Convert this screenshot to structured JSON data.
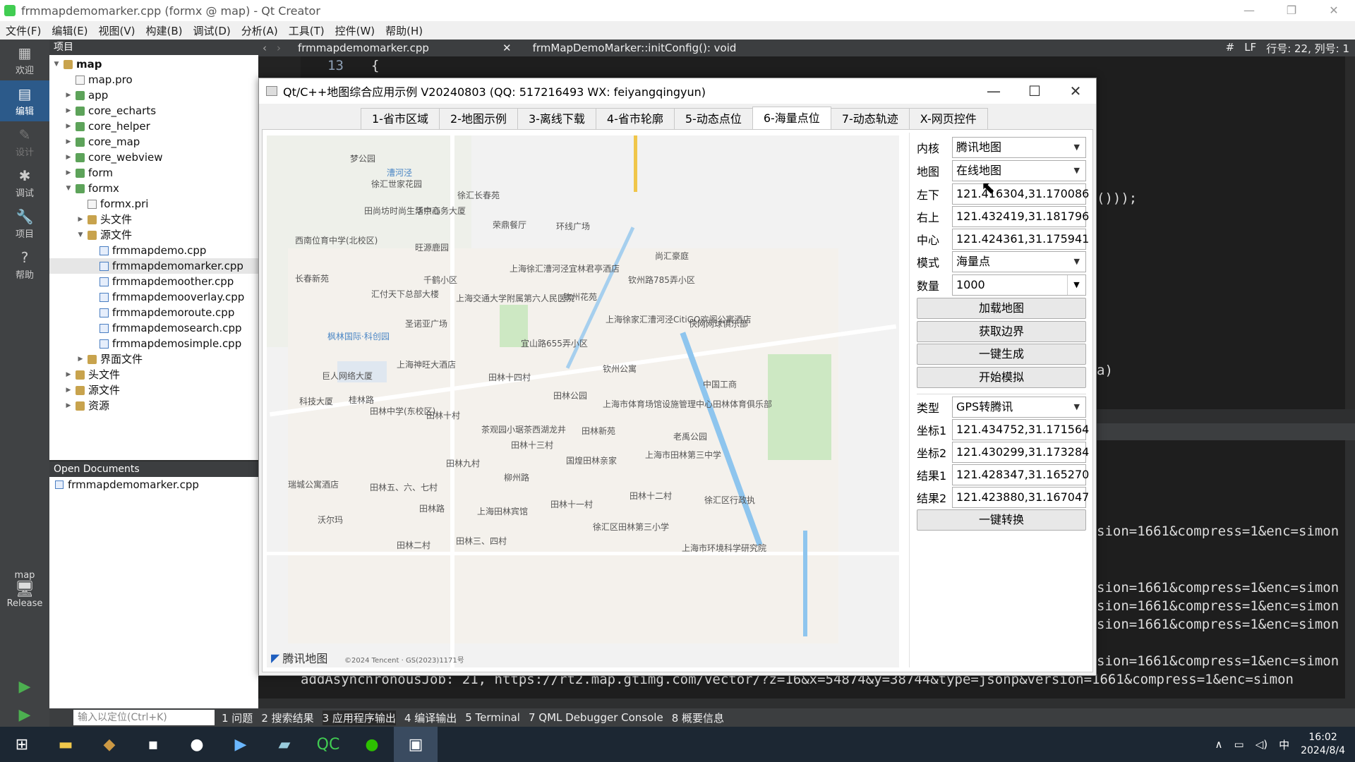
{
  "qc": {
    "title": "frmmapdemomarker.cpp (formx @ map) - Qt Creator",
    "menu": [
      "文件(F)",
      "编辑(E)",
      "视图(V)",
      "构建(B)",
      "调试(D)",
      "分析(A)",
      "工具(T)",
      "控件(W)",
      "帮助(H)"
    ],
    "modes": [
      {
        "label": "欢迎",
        "icon": "▦"
      },
      {
        "label": "编辑",
        "icon": "▤"
      },
      {
        "label": "设计",
        "icon": "✎"
      },
      {
        "label": "调试",
        "icon": "✱"
      },
      {
        "label": "项目",
        "icon": "🔧"
      },
      {
        "label": "帮助",
        "icon": "?"
      }
    ],
    "kit": {
      "name": "map",
      "config": "Release"
    },
    "project_header": "项目",
    "tree": [
      {
        "indent": 0,
        "arrow": "▼",
        "icon": "proj",
        "label": "map",
        "bold": true
      },
      {
        "indent": 1,
        "arrow": "",
        "icon": "file",
        "label": "map.pro"
      },
      {
        "indent": 1,
        "arrow": "▶",
        "icon": "folder",
        "label": "app"
      },
      {
        "indent": 1,
        "arrow": "▶",
        "icon": "folder",
        "label": "core_echarts"
      },
      {
        "indent": 1,
        "arrow": "▶",
        "icon": "folder",
        "label": "core_helper"
      },
      {
        "indent": 1,
        "arrow": "▶",
        "icon": "folder",
        "label": "core_map"
      },
      {
        "indent": 1,
        "arrow": "▶",
        "icon": "folder",
        "label": "core_webview"
      },
      {
        "indent": 1,
        "arrow": "▶",
        "icon": "folder",
        "label": "form"
      },
      {
        "indent": 1,
        "arrow": "▼",
        "icon": "folder",
        "label": "formx"
      },
      {
        "indent": 2,
        "arrow": "",
        "icon": "file",
        "label": "formx.pri"
      },
      {
        "indent": 2,
        "arrow": "▶",
        "icon": "proj",
        "label": "头文件"
      },
      {
        "indent": 2,
        "arrow": "▼",
        "icon": "proj",
        "label": "源文件"
      },
      {
        "indent": 3,
        "arrow": "",
        "icon": "cpp",
        "label": "frmmapdemo.cpp"
      },
      {
        "indent": 3,
        "arrow": "",
        "icon": "cpp",
        "label": "frmmapdemomarker.cpp",
        "selected": true
      },
      {
        "indent": 3,
        "arrow": "",
        "icon": "cpp",
        "label": "frmmapdemoother.cpp"
      },
      {
        "indent": 3,
        "arrow": "",
        "icon": "cpp",
        "label": "frmmapdemooverlay.cpp"
      },
      {
        "indent": 3,
        "arrow": "",
        "icon": "cpp",
        "label": "frmmapdemoroute.cpp"
      },
      {
        "indent": 3,
        "arrow": "",
        "icon": "cpp",
        "label": "frmmapdemosearch.cpp"
      },
      {
        "indent": 3,
        "arrow": "",
        "icon": "cpp",
        "label": "frmmapdemosimple.cpp"
      },
      {
        "indent": 2,
        "arrow": "▶",
        "icon": "proj",
        "label": "界面文件"
      },
      {
        "indent": 1,
        "arrow": "▶",
        "icon": "proj",
        "label": "头文件"
      },
      {
        "indent": 1,
        "arrow": "▶",
        "icon": "proj",
        "label": "源文件"
      },
      {
        "indent": 1,
        "arrow": "▶",
        "icon": "proj",
        "label": "资源"
      }
    ],
    "open_docs_header": "Open Documents",
    "open_docs": [
      "frmmapdemomarker.cpp"
    ],
    "editor": {
      "file": "frmmapdemomarker.cpp",
      "function": "frmMapDemoMarker::initConfig(): void",
      "hash": "#",
      "eol": "LF",
      "position": "行号: 22, 列号: 1",
      "line_no": "13",
      "line_code": "{",
      "frag1": "()));",
      "frag2": "a)"
    },
    "output_lines": [
      "sion=1661&compress=1&enc=simon",
      "sion=1661&compress=1&enc=simon",
      "sion=1661&compress=1&enc=simon",
      "sion=1661&compress=1&enc=simon",
      "sion=1661&compress=1&enc=simon",
      "addAsynchronousJob: 21, https://rt2.map.gtimg.com/vector/?z=16&x=54874&y=38744&type=jsonp&version=1661&compress=1&enc=simon"
    ],
    "locator_placeholder": "输入以定位(Ctrl+K)",
    "panes": [
      "1 问题",
      "2 搜索结果",
      "3 应用程序输出",
      "4 编译输出",
      "5 Terminal",
      "7 QML Debugger Console",
      "8 概要信息"
    ]
  },
  "demo": {
    "title": "Qt/C++地图综合应用示例 V20240803 (QQ: 517216493 WX: feiyangqingyun)",
    "tabs": [
      "1-省市区域",
      "2-地图示例",
      "3-离线下载",
      "4-省市轮廓",
      "5-动态点位",
      "6-海量点位",
      "7-动态轨迹",
      "X-网页控件"
    ],
    "active_tab": 5,
    "controls": {
      "core_label": "内核",
      "core_value": "腾讯地图",
      "map_label": "地图",
      "map_value": "在线地图",
      "lb_label": "左下",
      "lb_value": "121.416304,31.170086",
      "rt_label": "右上",
      "rt_value": "121.432419,31.181796",
      "center_label": "中心",
      "center_value": "121.424361,31.175941",
      "mode_label": "模式",
      "mode_value": "海量点",
      "count_label": "数量",
      "count_value": "1000",
      "btn_load": "加载地图",
      "btn_bounds": "获取边界",
      "btn_generate": "一键生成",
      "btn_simulate": "开始模拟",
      "type_label": "类型",
      "type_value": "GPS转腾讯",
      "c1_label": "坐标1",
      "c1_value": "121.434752,31.171564",
      "c2_label": "坐标2",
      "c2_value": "121.430299,31.173284",
      "r1_label": "结果1",
      "r1_value": "121.428347,31.165270",
      "r2_label": "结果2",
      "r2_value": "121.423880,31.167047",
      "btn_convert": "一键转换"
    },
    "map": {
      "logo": "腾讯地图",
      "copyright": "©2024 Tencent · GS(2023)1171号",
      "labels": [
        "梦公园",
        "漕河泾",
        "徐汇世家花园",
        "徐汇长春苑",
        "田尚坊时尚生活中心",
        "华京商务大厦",
        "荣鼎餐厅",
        "环线广场",
        "西南位育中学(北校区)",
        "旺源鹿园",
        "长春新苑",
        "千鹤小区",
        "上海徐汇漕河泾宜林君亭酒店",
        "钦州路785弄小区",
        "尚汇豪庭",
        "汇付天下总部大楼",
        "上海交通大学附属第六人民医院",
        "钦州花苑",
        "圣诺亚广场",
        "上海徐家汇漕河泾CitiGO欢阁公寓酒店",
        "快网网球俱乐部",
        "枫林国际·科创园",
        "宜山路655弄小区",
        "上海神旺大酒店",
        "巨人网络大厦",
        "田林十四村",
        "钦州公寓",
        "中国工商",
        "桂林路",
        "田林中学(东校区)",
        "田林公园",
        "上海市体育场馆设施管理中心田林体育俱乐部",
        "科技大厦",
        "田林十村",
        "茶观园小琚茶西湖龙井",
        "田林新苑",
        "田林十三村",
        "老禹公园",
        "田林九村",
        "国煌田林亲家",
        "上海市田林第三中学",
        "瑞城公寓酒店",
        "田林五、六、七村",
        "柳州路",
        "田林十二村",
        "田林十一村",
        "上海田林宾馆",
        "田林路",
        "沃尔玛",
        "徐汇区田林第三小学",
        "田林二村",
        "田林三、四村",
        "上海市环境科学研究院",
        "徐汇区行政执"
      ]
    }
  }
}
